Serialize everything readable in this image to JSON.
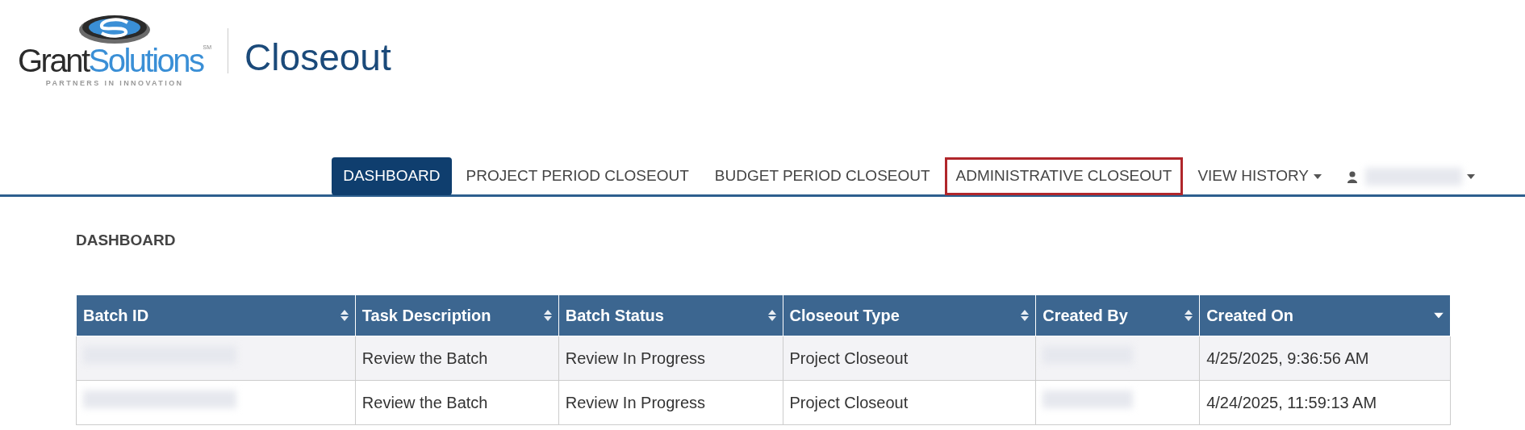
{
  "brand": {
    "name_dark": "Grant",
    "name_blue": "Solutions",
    "service_mark": "SM",
    "tagline": "PARTNERS IN INNOVATION",
    "app_title": "Closeout"
  },
  "nav": [
    {
      "kind": "link",
      "label": "DASHBOARD",
      "selected": true,
      "highlighted": false,
      "dropdown": false
    },
    {
      "kind": "link",
      "label": "PROJECT PERIOD CLOSEOUT",
      "selected": false,
      "highlighted": false,
      "dropdown": false
    },
    {
      "kind": "link",
      "label": "BUDGET PERIOD CLOSEOUT",
      "selected": false,
      "highlighted": false,
      "dropdown": false
    },
    {
      "kind": "link",
      "label": "ADMINISTRATIVE CLOSEOUT",
      "selected": false,
      "highlighted": true,
      "dropdown": false
    },
    {
      "kind": "link",
      "label": "VIEW HISTORY",
      "selected": false,
      "highlighted": false,
      "dropdown": true
    },
    {
      "kind": "user",
      "selected": false,
      "highlighted": false,
      "dropdown": true
    }
  ],
  "page_title": "DASHBOARD",
  "table": {
    "columns": [
      {
        "label": "Batch ID",
        "sorted_descending": false
      },
      {
        "label": "Task Description",
        "sorted_descending": false
      },
      {
        "label": "Batch Status",
        "sorted_descending": false
      },
      {
        "label": "Closeout Type",
        "sorted_descending": false
      },
      {
        "label": "Created By",
        "sorted_descending": false
      },
      {
        "label": "Created On",
        "sorted_descending": true
      }
    ],
    "rows": [
      {
        "cells": [
          {
            "kind": "redacted"
          },
          {
            "kind": "text",
            "text": "Review the Batch"
          },
          {
            "kind": "text",
            "text": "Review In Progress"
          },
          {
            "kind": "text",
            "text": "Project Closeout"
          },
          {
            "kind": "redacted"
          },
          {
            "kind": "text",
            "text": "4/25/2025, 9:36:56 AM"
          }
        ]
      },
      {
        "cells": [
          {
            "kind": "redacted"
          },
          {
            "kind": "text",
            "text": "Review the Batch"
          },
          {
            "kind": "text",
            "text": "Review In Progress"
          },
          {
            "kind": "text",
            "text": "Project Closeout"
          },
          {
            "kind": "redacted"
          },
          {
            "kind": "text",
            "text": "4/24/2025, 11:59:13 AM"
          }
        ]
      }
    ]
  }
}
